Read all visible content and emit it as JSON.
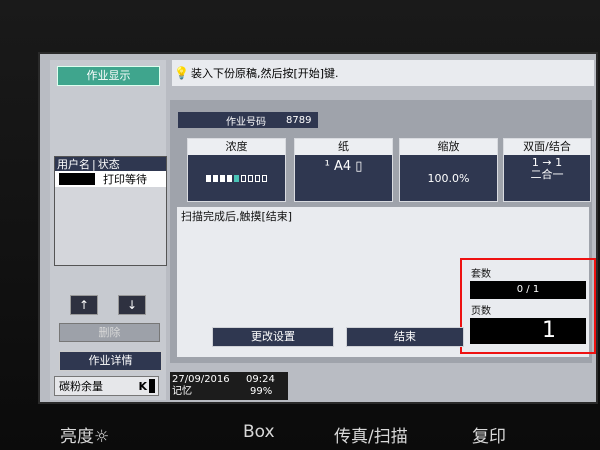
{
  "left_panel": {
    "job_display_label": "作业显示",
    "user_table_headers": [
      "用户名",
      "状态"
    ],
    "user_rows": [
      {
        "status": "打印等待"
      }
    ],
    "arrow_up": "↑",
    "arrow_down": "↓",
    "delete_label": "删除",
    "job_detail_label": "作业详情",
    "toner_label": "碳粉余量",
    "toner_color": "K"
  },
  "top_message": "装入下份原稿,然后按[开始]键.",
  "job": {
    "label": "作业号码",
    "number": "8789"
  },
  "tiles": [
    {
      "header": "浓度",
      "value": ""
    },
    {
      "header": "纸",
      "value": "¹ A4 ▯"
    },
    {
      "header": "缩放",
      "value": "100.0%"
    },
    {
      "header": "双面/结合",
      "value": "1 → 1\n二合一"
    }
  ],
  "density_levels": 9,
  "density_selected": 5,
  "scan_message": "扫描完成后,触摸[结束]",
  "sets": {
    "label": "套数",
    "value": "0 / 1"
  },
  "pages": {
    "label": "页数",
    "value": "1"
  },
  "buttons": {
    "change_settings": "更改设置",
    "finish": "结束"
  },
  "status": {
    "date": "27/09/2016",
    "time": "09:24",
    "memory_label": "记忆",
    "memory_value": "99%"
  },
  "physical_buttons": [
    "亮度☼",
    "Box",
    "传真/扫描",
    "复印"
  ],
  "colors": {
    "teal": "#3fa58d",
    "navy": "#2f3750",
    "highlight": "#e11"
  }
}
